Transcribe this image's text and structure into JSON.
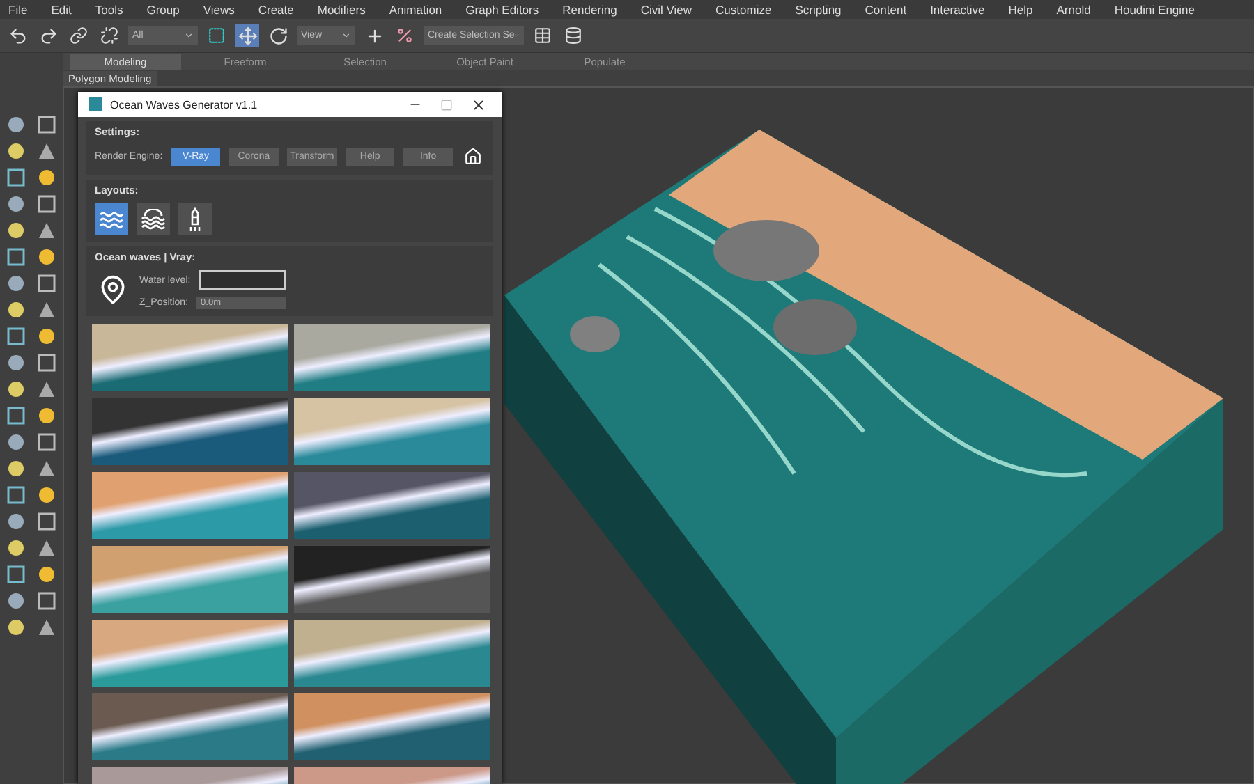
{
  "menu_bar": [
    "File",
    "Edit",
    "Tools",
    "Group",
    "Views",
    "Create",
    "Modifiers",
    "Animation",
    "Graph Editors",
    "Rendering",
    "Civil View",
    "Customize",
    "Scripting",
    "Content",
    "Interactive",
    "Help",
    "Arnold",
    "Houdini Engine"
  ],
  "toolbar": {
    "selection_filter": "All",
    "coordinate_system": "View",
    "selection_set": "Create Selection Se"
  },
  "ribbon": {
    "tabs": [
      {
        "label": "Modeling",
        "selected": true
      },
      {
        "label": "Freeform",
        "selected": false
      },
      {
        "label": "Selection",
        "selected": false
      },
      {
        "label": "Object Paint",
        "selected": false
      },
      {
        "label": "Populate",
        "selected": false
      }
    ],
    "panel": "Polygon Modeling"
  },
  "dialog": {
    "title": "Ocean Waves Generator v1.1",
    "settings": {
      "title": "Settings:",
      "engine_label": "Render Engine:",
      "buttons": [
        {
          "label": "V-Ray",
          "selected": true
        },
        {
          "label": "Corona",
          "selected": false
        },
        {
          "label": "Transform",
          "selected": false
        },
        {
          "label": "Help",
          "selected": false
        },
        {
          "label": "Info",
          "selected": false
        }
      ]
    },
    "layouts": {
      "title": "Layouts:",
      "items": [
        {
          "kind": "waves",
          "selected": true
        },
        {
          "kind": "sea",
          "selected": false
        },
        {
          "kind": "buoy",
          "selected": false
        }
      ]
    },
    "ocean": {
      "title": "Ocean waves | Vray:",
      "water_level_label": "Water level:",
      "z_position_label": "Z_Position:",
      "z_position_value": "0.0m"
    }
  }
}
